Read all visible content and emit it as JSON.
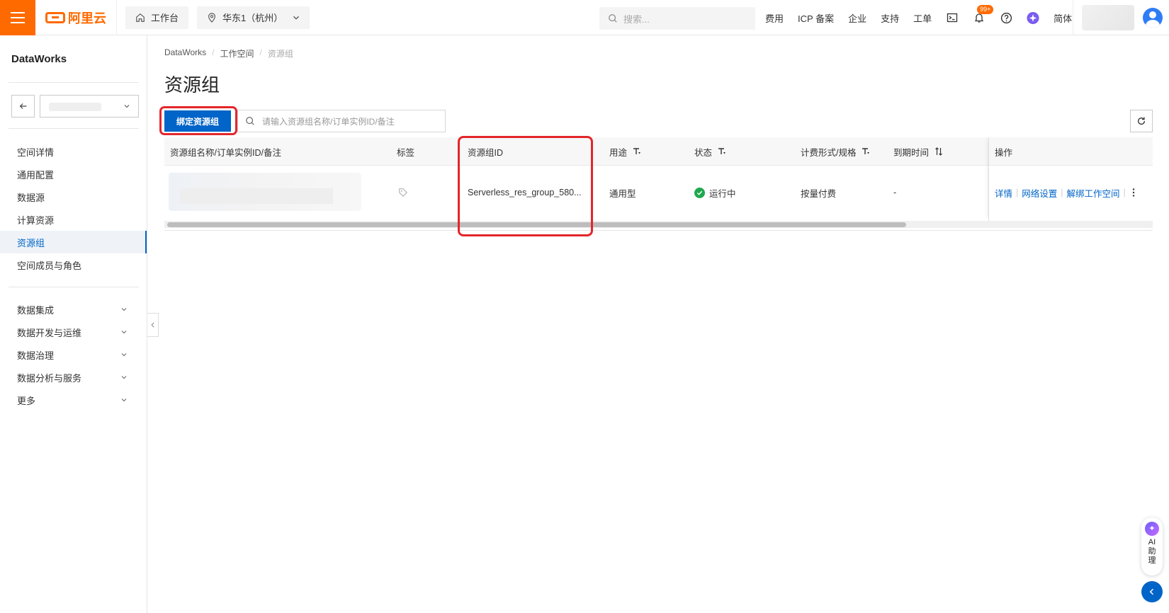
{
  "topbar": {
    "brand": "阿里云",
    "workbench": "工作台",
    "region": "华东1（杭州）",
    "search_placeholder": "搜索...",
    "links": [
      "费用",
      "ICP 备案",
      "企业",
      "支持",
      "工单"
    ],
    "notification_badge": "99+",
    "language": "简体"
  },
  "sidebar": {
    "title": "DataWorks",
    "items": [
      "空间详情",
      "通用配置",
      "数据源",
      "计算资源",
      "资源组",
      "空间成员与角色"
    ],
    "active_item": "资源组",
    "groups": [
      "数据集成",
      "数据开发与运维",
      "数据治理",
      "数据分析与服务",
      "更多"
    ]
  },
  "breadcrumb": [
    "DataWorks",
    "工作空间",
    "资源组"
  ],
  "page": {
    "title": "资源组",
    "bind_button": "绑定资源组",
    "search_placeholder": "请输入资源组名称/订单实例ID/备注"
  },
  "table": {
    "columns": [
      "资源组名称/订单实例ID/备注",
      "标签",
      "资源组ID",
      "用途",
      "状态",
      "计费形式/规格",
      "到期时间",
      "操作"
    ],
    "rows": [
      {
        "resource_group_id": "Serverless_res_group_580...",
        "usage": "通用型",
        "status": "运行中",
        "billing": "按量付费",
        "expiry": "-",
        "actions": [
          "详情",
          "网络设置",
          "解绑工作空间"
        ]
      }
    ]
  },
  "ai_assistant": {
    "label_lines": [
      "AI",
      "助",
      "理"
    ]
  },
  "colors": {
    "brand_orange": "#ff6a00",
    "primary_blue": "#0064c8",
    "highlight_red": "#e3262b",
    "status_green": "#1fa84f"
  }
}
